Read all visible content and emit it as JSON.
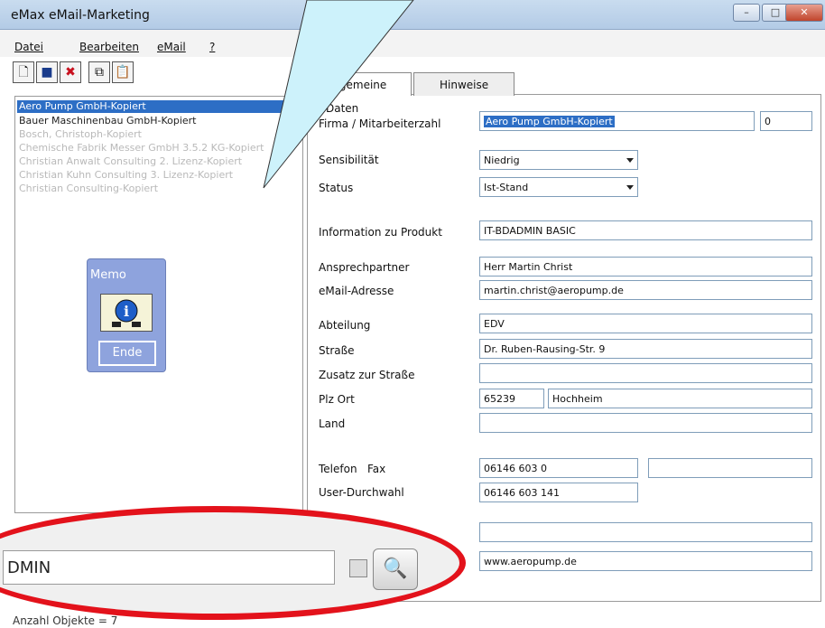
{
  "window": {
    "title": "eMax  eMail-Marketing"
  },
  "menu": [
    "Datei",
    "Bearbeiten",
    "eMail",
    "?"
  ],
  "list": {
    "items": [
      "Aero Pump GmbH-Kopiert",
      "Bauer Maschinenbau GmbH-Kopiert",
      "Bosch, Christoph-Kopiert",
      "Chemische Fabrik Messer GmbH 3.5.2 KG-Kopiert",
      "Christian Anwalt Consulting 2. Lizenz-Kopiert",
      "Christian Kuhn Consulting 3. Lizenz-Kopiert",
      "Christian Consulting-Kopiert"
    ]
  },
  "memo": {
    "title": "Memo",
    "button": "Ende"
  },
  "tabs": [
    "Allgemeine Daten",
    "Hinweise"
  ],
  "form": {
    "firma_label": "Firma / Mitarbeiterzahl",
    "firma_value": "Aero Pump GmbH-Kopiert",
    "mitarbeiter_value": "0",
    "sensibilitaet_label": "Sensibilität",
    "sensibilitaet_value": "Niedrig",
    "status_label": "Status",
    "status_value": "Ist-Stand",
    "produkt_label": "Information zu Produkt",
    "produkt_value": "IT-BDADMIN BASIC",
    "ansprech_label": "Ansprechpartner",
    "ansprech_value": "Herr Martin Christ",
    "email_label": "eMail-Adresse",
    "email_value": "martin.christ@aeropump.de",
    "abteilung_label": "Abteilung",
    "abteilung_value": "EDV",
    "strasse_label": "Straße",
    "strasse_value": "Dr. Ruben-Rausing-Str. 9",
    "zusatz_label": "Zusatz zur Straße",
    "zusatz_value": "",
    "plzort_label": "Plz Ort",
    "plz_value": "65239",
    "ort_value": "Hochheim",
    "land_label": "Land",
    "land_value": "",
    "telefon_label": "Telefon   Fax",
    "telefon_value": "06146 603 0",
    "fax_value": "",
    "durchwahl_label": "User-Durchwahl",
    "durchwahl_value": "06146 603 141",
    "extra_value": "",
    "web_value": "www.aeropump.de"
  },
  "zoom": {
    "search_value": "DMIN"
  },
  "status": {
    "text": "Anzahl Objekte = 7"
  }
}
